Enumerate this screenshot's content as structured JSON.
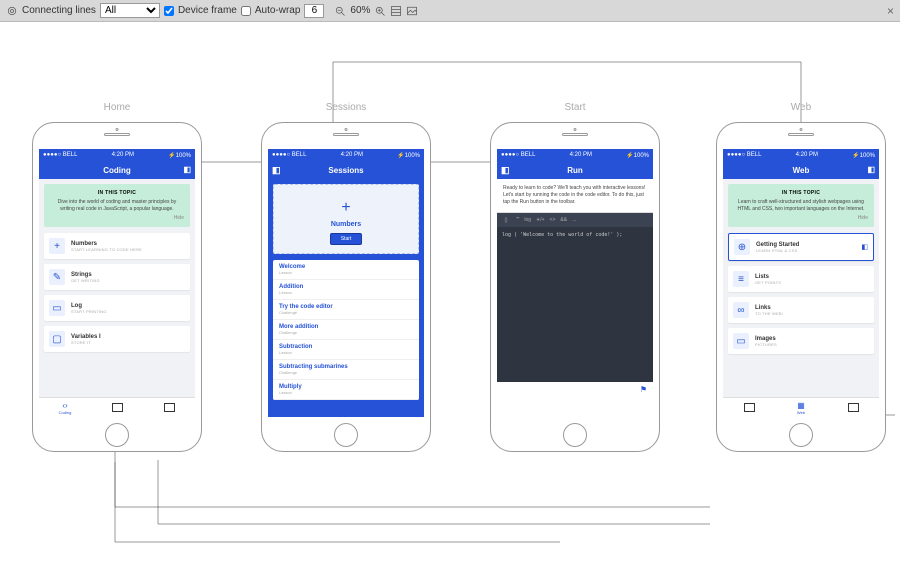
{
  "toolbar": {
    "connecting_label": "Connecting lines",
    "filter": "All",
    "device_frame_label": "Device frame",
    "device_frame_checked": true,
    "autowrap_label": "Auto-wrap",
    "autowrap_checked": false,
    "autowrap_value": "6",
    "zoom": "60%"
  },
  "frames": [
    {
      "title": "Home"
    },
    {
      "title": "Sessions"
    },
    {
      "title": "Start"
    },
    {
      "title": "Web"
    }
  ],
  "status": {
    "carrier": "●●●●○ BELL",
    "time": "4:20 PM",
    "batt": "⚡100%"
  },
  "home": {
    "header": "Coding",
    "topic_label": "IN THIS TOPIC",
    "topic_desc": "Dive into the world of coding and master principles by writing real code in JavaScript, a popular language.",
    "hide": "Hide",
    "items": [
      {
        "icon": "+",
        "title": "Numbers",
        "sub": "START LEARNING TO CODE HERE"
      },
      {
        "icon": "✎",
        "title": "Strings",
        "sub": "GET WRITING"
      },
      {
        "icon": "▭",
        "title": "Log",
        "sub": "START PRINTING"
      },
      {
        "icon": "▢",
        "title": "Variables I",
        "sub": "STORE IT"
      }
    ],
    "tabs": [
      {
        "label": "Coding"
      },
      {
        "label": ""
      },
      {
        "label": ""
      }
    ]
  },
  "sessions": {
    "header": "Sessions",
    "card_title": "Numbers",
    "card_btn": "Start",
    "items": [
      {
        "t": "Welcome",
        "s": "Lesson"
      },
      {
        "t": "Addition",
        "s": "Lesson"
      },
      {
        "t": "Try the code editor",
        "s": "Challenge"
      },
      {
        "t": "More addition",
        "s": "Challenge"
      },
      {
        "t": "Subtraction",
        "s": "Lesson"
      },
      {
        "t": "Subtracting submarines",
        "s": "Challenge"
      },
      {
        "t": "Multiply",
        "s": "Lesson"
      }
    ]
  },
  "run": {
    "header": "Run",
    "desc": "Ready to learn to code? We'll teach you with interactive lessons! Let's start by running the code in the code editor. To do this, just tap the Run button in the toolbar.",
    "tb": [
      "｛｝",
      "“”",
      "log",
      "∗/+",
      "<>",
      "&&",
      "..."
    ],
    "code": "log ( 'Welcome to the world of code!' );"
  },
  "web": {
    "header": "Web",
    "topic_label": "IN THIS TOPIC",
    "topic_desc": "Learn to craft well-structured and stylish webpages using HTML and CSS, two important languages on the Internet.",
    "hide": "Hide",
    "items": [
      {
        "icon": "⊕",
        "title": "Getting Started",
        "sub": "LEARN HTML & CSS"
      },
      {
        "icon": "≡",
        "title": "Lists",
        "sub": "GET POINTS"
      },
      {
        "icon": "∞",
        "title": "Links",
        "sub": "TO THE WEB!"
      },
      {
        "icon": "▭",
        "title": "Images",
        "sub": "PICTURES"
      }
    ],
    "tabs": [
      {
        "label": ""
      },
      {
        "label": "Web"
      },
      {
        "label": ""
      }
    ]
  }
}
